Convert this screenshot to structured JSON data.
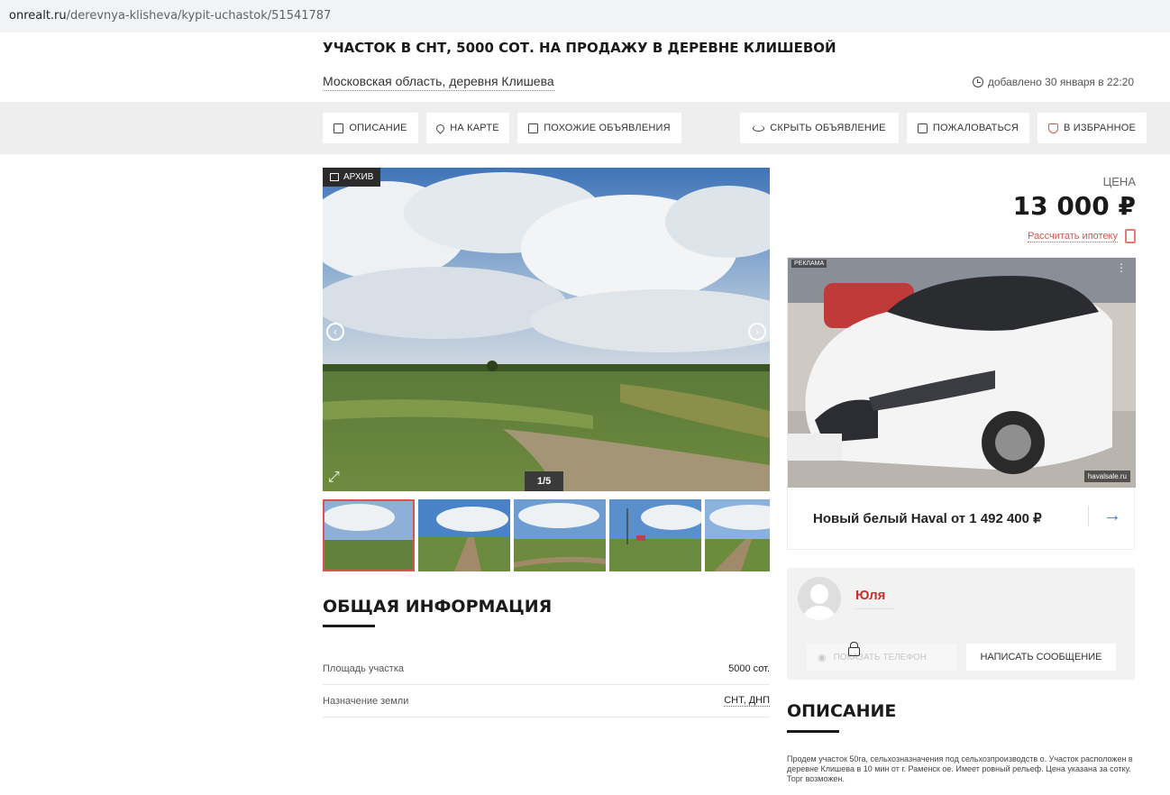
{
  "browser": {
    "url_host": "onrealt.ru",
    "url_path": "/derevnya-klisheva/kypit-uchastok/51541787"
  },
  "listing": {
    "title": "УЧАСТОК В СНТ, 5000 СОТ. НА ПРОДАЖУ В ДЕРЕВНЕ КЛИШЕВОЙ",
    "address": "Московская область, деревня Клишева",
    "added": "добавлено 30 января в 22:20"
  },
  "toolbar": {
    "description": "ОПИСАНИЕ",
    "map": "НА КАРТЕ",
    "similar": "ПОХОЖИЕ ОБЪЯВЛЕНИЯ",
    "hide": "СКРЫТЬ ОБЪЯВЛЕНИЕ",
    "report": "ПОЖАЛОВАТЬСЯ",
    "favorite": "В ИЗБРАННОЕ"
  },
  "gallery": {
    "badge": "АРХИВ",
    "counter": "1/5",
    "current": 1,
    "total": 5
  },
  "info": {
    "heading": "ОБЩАЯ ИНФОРМАЦИЯ",
    "rows": [
      {
        "key": "Площадь участка",
        "value": "5000 сот."
      },
      {
        "key": "Назначение земли",
        "value": "СНТ, ДНП"
      }
    ]
  },
  "price": {
    "label": "ЦЕНА",
    "value": "13 000 ₽",
    "mortgage_link": "Рассчитать ипотеку"
  },
  "ad": {
    "tag": "РЕКЛАМА",
    "logo_text": "havalsale.ru",
    "text": "Новый белый Haval от 1 492 400 ₽"
  },
  "seller": {
    "name": "Юля",
    "show_phone": "ПОКАЗАТЬ ТЕЛЕФОН",
    "write_message": "НАПИСАТЬ СООБЩЕНИЕ"
  },
  "description": {
    "heading": "ОПИСАНИЕ",
    "text": "Продем участок 50га, сельхозназначения под сельхозпроизводств о.  Участок расположен в деревне Клишева в 10 мин от г. Раменск ое.  Имеет ровный рельеф. Цена указана за сотку.  Торг возможен."
  },
  "colors": {
    "accent": "#d9534f",
    "link_blue": "#3d7bd9",
    "toolbar_bg": "#eeeeee"
  }
}
